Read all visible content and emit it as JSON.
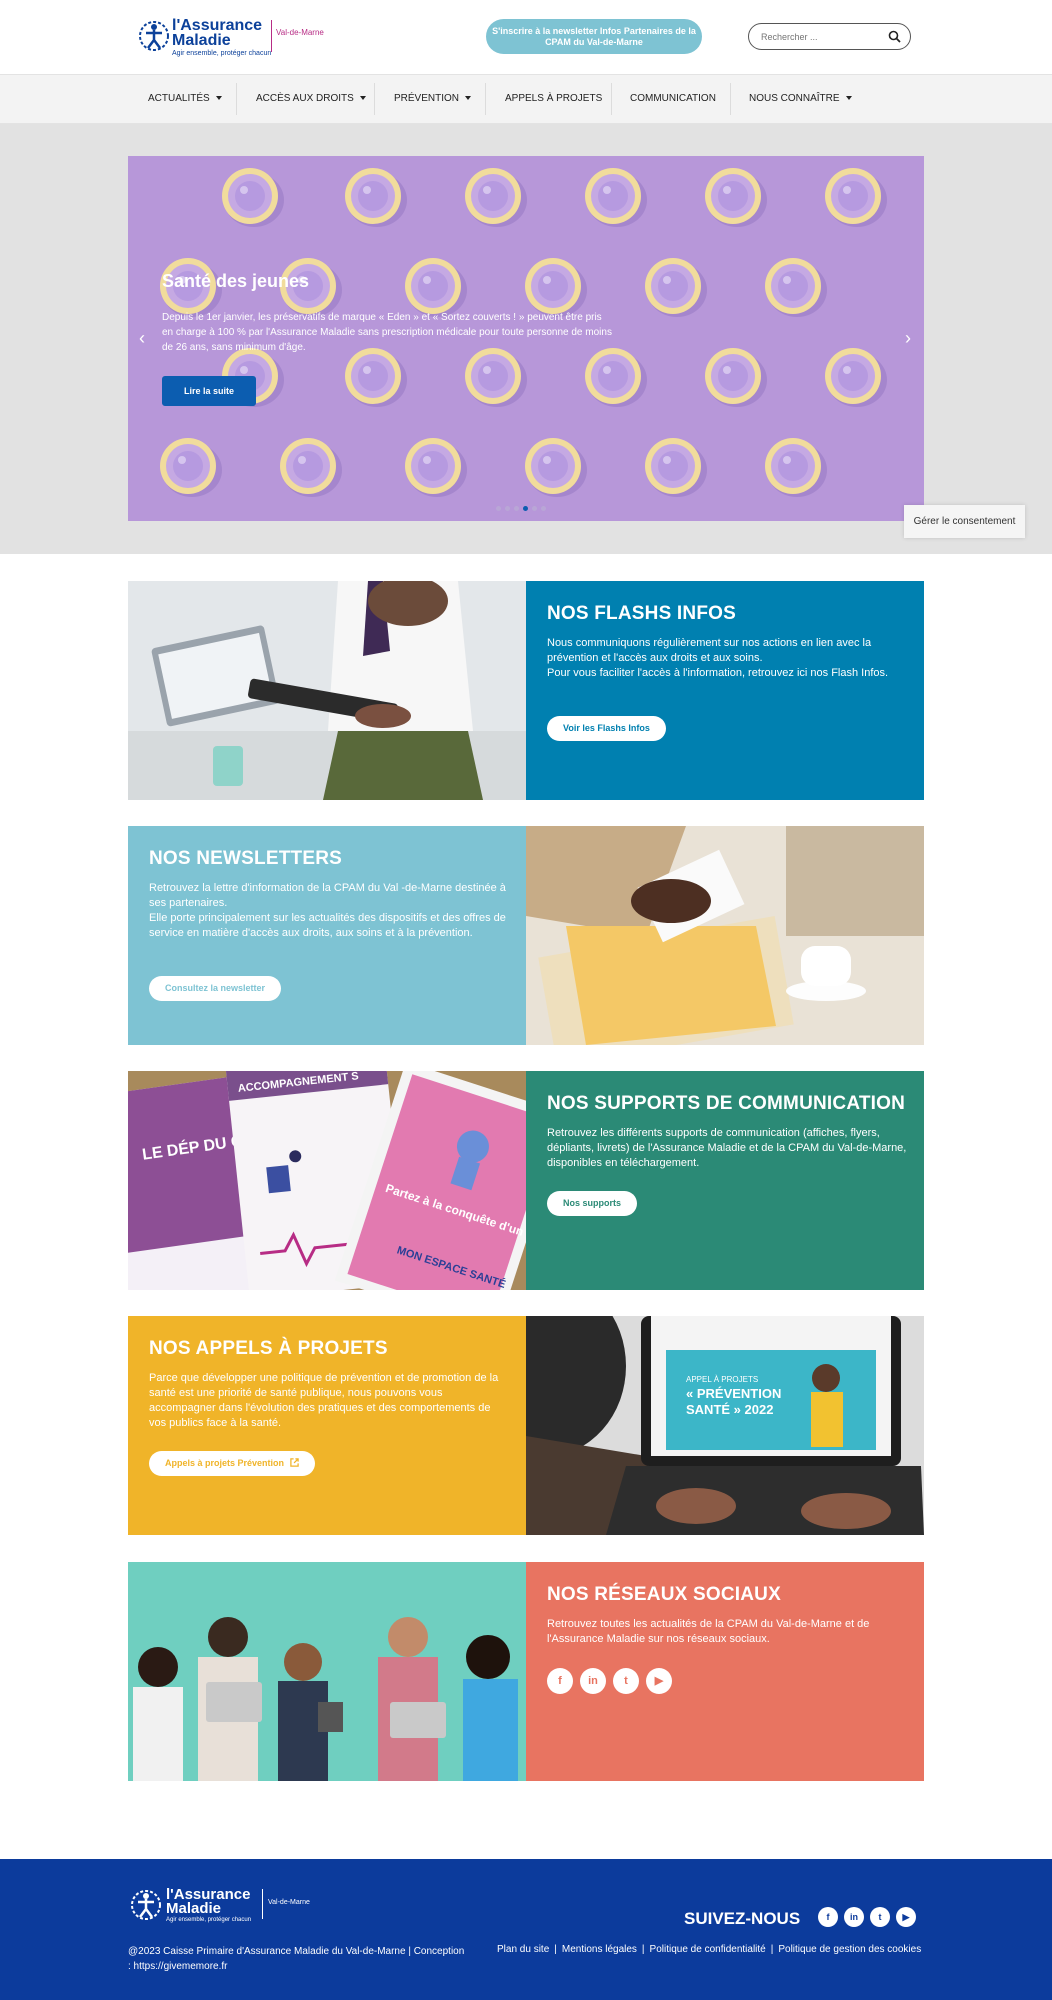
{
  "header": {
    "logo": {
      "brand_line1": "l'Assurance",
      "brand_line2": "Maladie",
      "tagline": "Agir ensemble, protéger chacun",
      "region": "Val-de-Marne"
    },
    "newsletter_button": "S'inscrire à la newsletter Infos Partenaires de la CPAM du Val-de-Marne",
    "search_placeholder": "Rechercher ..."
  },
  "nav": {
    "items": [
      {
        "label": "ACTUALITÉS",
        "dropdown": true
      },
      {
        "label": "ACCÈS AUX DROITS",
        "dropdown": true
      },
      {
        "label": "PRÉVENTION",
        "dropdown": true
      },
      {
        "label": "APPELS À PROJETS",
        "dropdown": false
      },
      {
        "label": "COMMUNICATION",
        "dropdown": false
      },
      {
        "label": "NOUS CONNAÎTRE",
        "dropdown": true
      }
    ]
  },
  "hero": {
    "title": "Santé des jeunes",
    "text": "Depuis le 1er janvier, les préservatifs de marque « Eden » et « Sortez couverts ! » peuvent être pris en charge à 100 % par l'Assurance Maladie sans prescription médicale pour toute personne de moins de 26 ans, sans minimum d'âge.",
    "button": "Lire la suite",
    "prev_arrow": "‹",
    "next_arrow": "›",
    "slide_count": 6,
    "active_slide": 4
  },
  "consent_button": "Gérer le consentement",
  "cards": [
    {
      "title": "NOS FLASHS INFOS",
      "text": "Nous communiquons régulièrement sur nos actions en lien avec la prévention et l'accès aux droits et aux soins.\nPour vous faciliter l'accès à l'information, retrouvez ici nos Flash Infos.",
      "button": "Voir les Flashs Infos",
      "color": "#0080b0"
    },
    {
      "title": "NOS NEWSLETTERS",
      "text": "Retrouvez la lettre d'information de la CPAM du Val -de-Marne destinée à ses partenaires.\nElle porte principalement sur les actualités des dispositifs et des offres de service en matière d'accès aux droits, aux soins et à la prévention.",
      "button": "Consultez la newsletter",
      "color": "#7ec3d3"
    },
    {
      "title": "NOS SUPPORTS DE COMMUNICATION",
      "text": "Retrouvez les différents supports de communication (affiches, flyers, dépliants, livrets) de l'Assurance Maladie et de la CPAM du Val-de-Marne, disponibles en téléchargement.",
      "button": "Nos supports",
      "color": "#2b8a76",
      "image_texts": {
        "header": "ACCOMPAGNEMENT S",
        "left": "LE DÉP DU CA DU S",
        "pink": "Partez à la conquête d'un nouvel espace pour votre santé.",
        "logo": "MON ESPACE SANTÉ"
      }
    },
    {
      "title": "NOS APPELS À PROJETS",
      "text": "Parce que développer une politique de prévention et de promotion de la santé est une priorité de santé publique, nous pouvons vous accompagner dans l'évolution des pratiques et des comportements de vos publics face à la santé.",
      "button": "Appels à projets Prévention",
      "color": "#f0b429",
      "image_texts": {
        "small": "APPEL À PROJETS",
        "big1": "« PRÉVENTION",
        "big2": "SANTÉ » 2022"
      }
    },
    {
      "title": "NOS RÉSEAUX SOCIAUX",
      "text": "Retrouvez toutes les actualités de la CPAM du Val-de-Marne et de l'Assurance Maladie sur nos réseaux sociaux.",
      "color": "#e87461",
      "social": [
        "f",
        "in",
        "t",
        "▶"
      ]
    }
  ],
  "footer": {
    "logo": {
      "brand_line1": "l'Assurance",
      "brand_line2": "Maladie",
      "tagline": "Agir ensemble, protéger chacun",
      "region": "Val-de-Marne"
    },
    "follow_title": "SUIVEZ-NOUS",
    "social": [
      "f",
      "in",
      "t",
      "▶"
    ],
    "copyright": "@2023 Caisse Primaire d'Assurance Maladie du Val-de-Marne | Conception : https://givememore.fr",
    "links": [
      "Plan du site",
      "Mentions légales",
      "Politique de confidentialité",
      "Politique de gestion des cookies"
    ]
  }
}
